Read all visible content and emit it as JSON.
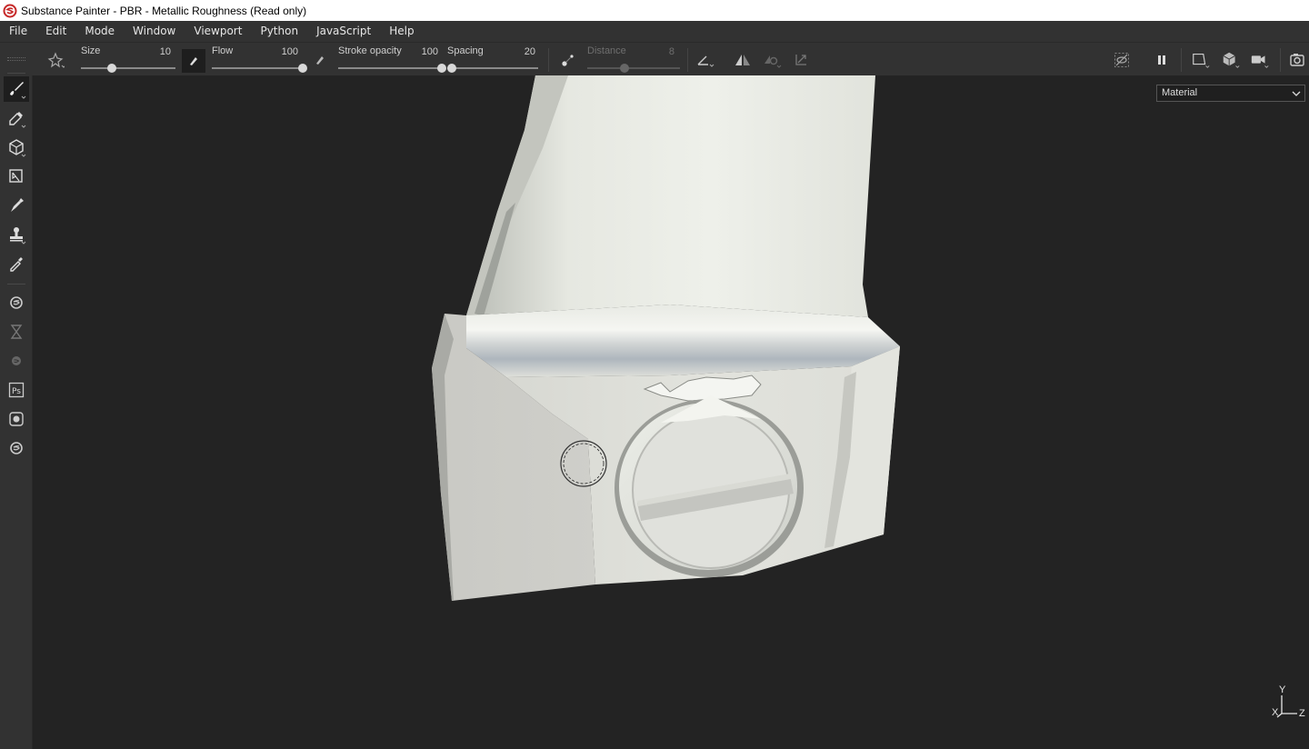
{
  "window": {
    "title": "Substance Painter - PBR - Metallic Roughness (Read only)"
  },
  "menu": [
    "File",
    "Edit",
    "Mode",
    "Window",
    "Viewport",
    "Python",
    "JavaScript",
    "Help"
  ],
  "toolbar": {
    "size": {
      "label": "Size",
      "value": "10",
      "level": 0.33
    },
    "flow": {
      "label": "Flow",
      "value": "100",
      "level": 1.0
    },
    "stroke_opacity": {
      "label": "Stroke opacity",
      "value": "100",
      "level": 1.0
    },
    "spacing": {
      "label": "Spacing",
      "value": "20",
      "level": 0.05
    },
    "distance": {
      "label": "Distance",
      "value": "8",
      "level": 0.4,
      "disabled": true
    }
  },
  "left_tools": [
    {
      "name": "paint-tool",
      "icon": "brush-icon",
      "active": true
    },
    {
      "name": "eraser-tool",
      "icon": "eraser-icon"
    },
    {
      "name": "projection-tool",
      "icon": "cube-projection-icon"
    },
    {
      "name": "polygon-fill-tool",
      "icon": "polygon-fill-icon"
    },
    {
      "name": "smudge-tool",
      "icon": "smudge-icon"
    },
    {
      "name": "clone-tool",
      "icon": "clone-stamp-icon"
    },
    {
      "name": "color-picker-tool",
      "icon": "eyedropper-icon"
    },
    {
      "name": "bake-tool",
      "icon": "substance-gear-icon"
    },
    {
      "name": "hourglass-tool",
      "icon": "hourglass-icon"
    },
    {
      "name": "substance-tool",
      "icon": "substance-dim-icon"
    },
    {
      "name": "photoshop-tool",
      "icon": "photoshop-icon"
    },
    {
      "name": "share-tool",
      "icon": "share-icon"
    },
    {
      "name": "substance-share-tool",
      "icon": "substance-share-icon"
    }
  ],
  "viewport": {
    "channel": "Material",
    "axes": {
      "x": "X",
      "y": "Y",
      "z": "Z"
    }
  },
  "colors": {
    "title_bg": "#ffffff",
    "panel_bg": "#323232",
    "viewport_bg": "#232323",
    "accent_icon": "#cc3333"
  }
}
